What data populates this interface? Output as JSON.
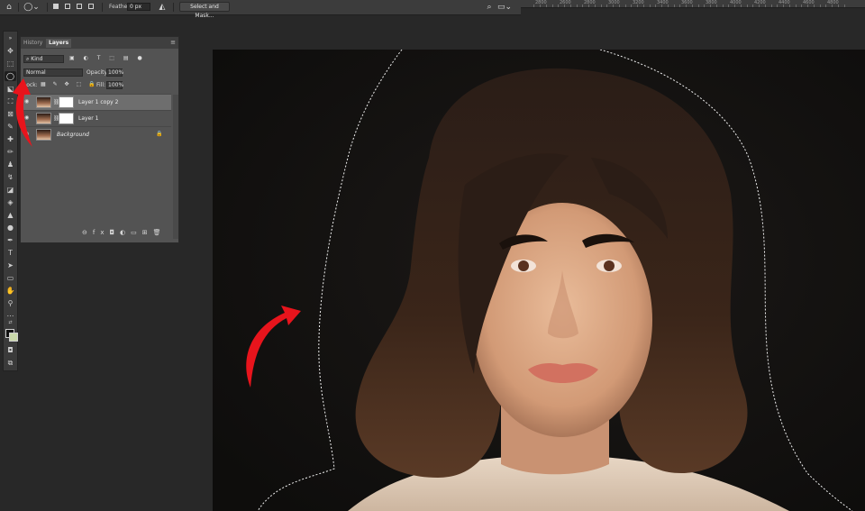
{
  "options_bar": {
    "feather_label": "Feather:",
    "feather_value": "0 px",
    "select_and_mask_label": "Select and Mask..."
  },
  "ruler": {
    "labels": [
      "2800",
      "2600",
      "2800",
      "3000",
      "3200",
      "3400",
      "3600",
      "3800",
      "4000",
      "4200",
      "4400",
      "4600",
      "4800"
    ]
  },
  "toolbar": {
    "active_tool": "lasso-tool",
    "foreground_color": "#111111",
    "background_color": "#c9d8a9"
  },
  "layers_panel": {
    "tabs": [
      {
        "label": "History"
      },
      {
        "label": "Layers"
      }
    ],
    "kind_filter": "Kind",
    "blend_mode": "Normal",
    "opacity_label": "Opacity:",
    "opacity_value": "100%",
    "lock_label": "Lock:",
    "fill_label": "Fill:",
    "fill_value": "100%",
    "layers": [
      {
        "name": "Layer 1 copy 2",
        "selected": true
      },
      {
        "name": "Layer 1",
        "selected": false
      },
      {
        "name": "Background",
        "selected": false
      }
    ]
  },
  "annotations": {
    "arrow_color": "#e8141c"
  }
}
